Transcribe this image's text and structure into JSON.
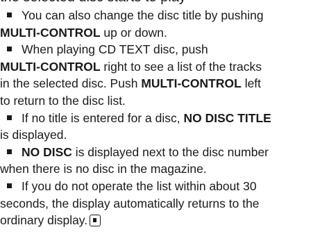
{
  "document": {
    "top_partial_line": "the selected disc starts to play",
    "items": [
      {
        "lines": [
          [
            {
              "text": "You can also change the disc title by pushing",
              "bold": false
            }
          ],
          [
            {
              "text": "MULTI-CONTROL",
              "bold": true
            },
            {
              "text": " up or down.",
              "bold": false
            }
          ]
        ]
      },
      {
        "lines": [
          [
            {
              "text": "When playing CD TEXT disc, push",
              "bold": false
            }
          ],
          [
            {
              "text": "MULTI-CONTROL",
              "bold": true
            },
            {
              "text": " right to see a list of the tracks",
              "bold": false
            }
          ],
          [
            {
              "text": "in the selected disc. Push ",
              "bold": false
            },
            {
              "text": "MULTI-CONTROL",
              "bold": true
            },
            {
              "text": " left",
              "bold": false
            }
          ],
          [
            {
              "text": "to return to the disc list.",
              "bold": false
            }
          ]
        ]
      },
      {
        "lines": [
          [
            {
              "text": "If no title is entered for a disc, ",
              "bold": false
            },
            {
              "text": "NO DISC TITLE",
              "bold": true
            }
          ],
          [
            {
              "text": "is displayed.",
              "bold": false
            }
          ]
        ]
      },
      {
        "lines": [
          [
            {
              "text": "NO DISC",
              "bold": true
            },
            {
              "text": " is displayed next to the disc number",
              "bold": false
            }
          ],
          [
            {
              "text": "when there is no disc in the magazine.",
              "bold": false
            }
          ]
        ]
      },
      {
        "lines": [
          [
            {
              "text": "If you do not operate the list within about 30",
              "bold": false
            }
          ],
          [
            {
              "text": "seconds, the display automatically returns to the",
              "bold": false
            }
          ],
          [
            {
              "text": "ordinary display.",
              "bold": false
            }
          ]
        ],
        "end_mark": true
      }
    ]
  }
}
